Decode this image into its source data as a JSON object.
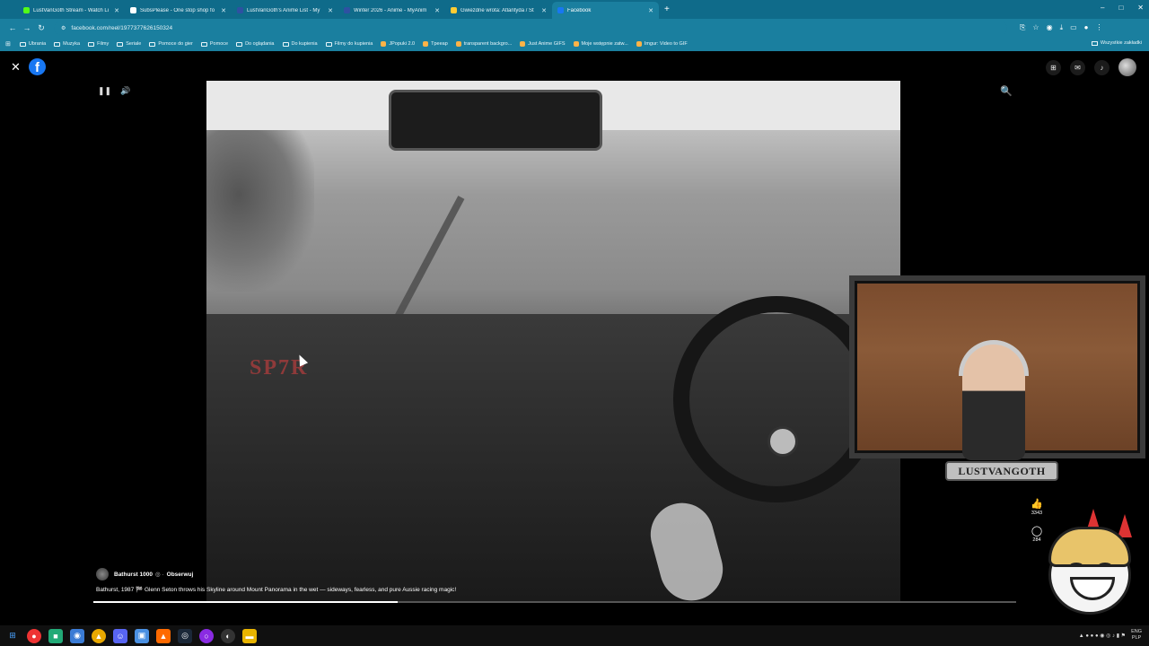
{
  "browser": {
    "tabs": [
      {
        "label": "LustVanGoth Stream - Watch Li",
        "color": "#53fc18",
        "active": false
      },
      {
        "label": "SubsPlease - One stop shop fo",
        "color": "#ffffff",
        "active": false
      },
      {
        "label": "LustVanGoth's Anime List - My",
        "color": "#2e51a2",
        "active": false
      },
      {
        "label": "Winter 2026 - Anime - MyAnim",
        "color": "#2e51a2",
        "active": false
      },
      {
        "label": "Gwiezdne wrota: Atlantyda / St",
        "color": "#ffcc33",
        "active": false
      },
      {
        "label": "Facebook",
        "color": "#1877f2",
        "active": true
      }
    ],
    "new_tab": "+",
    "window_controls": [
      "–",
      "□",
      "✕"
    ],
    "url": "facebook.com/reel/1977377626150324",
    "bookmarks": [
      "Ubrania",
      "Muzyka",
      "Filmy",
      "Seriale",
      "Pomoce do gier",
      "Pomoce",
      "Do oglądania",
      "Do kupienia",
      "Filmy do kupienia",
      "JPopuki 2.0",
      "Tpeeap",
      "transparent backgro...",
      "Just Anime GIFS",
      "Moje wstępnie zatw...",
      "Imgur: Video to GIF"
    ],
    "bookmarks_right": "Wszystkie zakładki"
  },
  "page": {
    "brand_letter": "f",
    "close_symbol": "✕",
    "pause_symbol": "❚❚",
    "volume_symbol": "🔊",
    "search_symbol": "🔍",
    "top_right_icons": [
      "grid-icon",
      "messenger-icon",
      "bell-icon"
    ],
    "video_overlay_text": "SP7R",
    "streamer_name": "LUSTVANGOTH",
    "likes": "3343",
    "comments": "284",
    "page_name": "Bathurst 1000",
    "follow_label": "Obserwuj",
    "caption": "Bathurst, 1987 🏁 Glenn Seton throws his Skyline around Mount Panorama in the wet — sideways, fearless, and pure Aussie racing magic!",
    "progress": 0.33
  },
  "taskbar": {
    "lang": "ENG",
    "lang2": "PLP"
  }
}
